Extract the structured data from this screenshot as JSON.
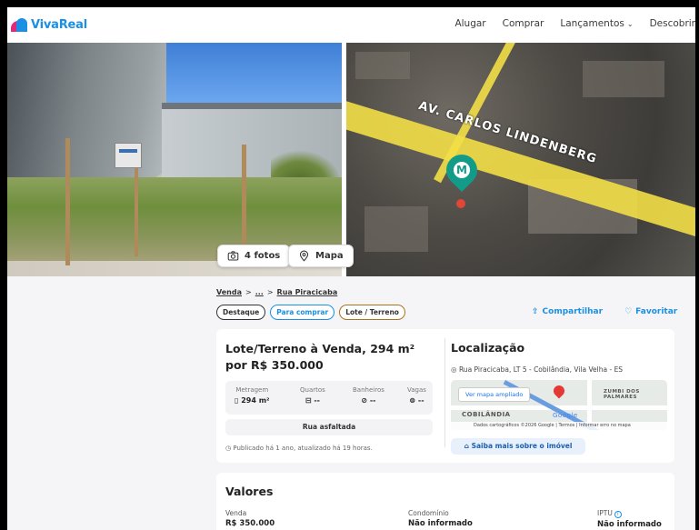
{
  "header": {
    "logo": "VivaReal",
    "nav": [
      {
        "label": "Alugar"
      },
      {
        "label": "Comprar"
      },
      {
        "label": "Lançamentos",
        "has_chevron": true
      },
      {
        "label": "Descobrir"
      }
    ]
  },
  "gallery": {
    "photos_button": "4 fotos",
    "map_button": "Mapa",
    "road_label": "AV. CARLOS LINDENBERG",
    "pin_letter": "M"
  },
  "breadcrumb": {
    "first": "Venda",
    "sep": ">",
    "middle": "...",
    "last": "Rua Piracicaba"
  },
  "tags": [
    "Destaque",
    "Para comprar",
    "Lote / Terreno"
  ],
  "actions": {
    "share": "Compartilhar",
    "favorite": "Favoritar"
  },
  "listing": {
    "title": "Lote/Terreno à Venda, 294 m² por R$ 350.000",
    "stats": [
      {
        "label": "Metragem",
        "value": "294 m²",
        "icon": "ruler-icon"
      },
      {
        "label": "Quartos",
        "value": "--",
        "icon": "bed-icon"
      },
      {
        "label": "Banheiros",
        "value": "--",
        "icon": "shower-icon"
      },
      {
        "label": "Vagas",
        "value": "--",
        "icon": "car-icon"
      }
    ],
    "feature": "Rua asfaltada",
    "published": "Publicado há 1 ano, atualizado há 19 horas."
  },
  "location": {
    "title": "Localização",
    "address": "Rua Piracicaba, LT 5 - Cobilândia, Vila Velha - ES",
    "map_button": "Ver mapa ampliado",
    "map_labels": {
      "district": "COBILÂNDIA",
      "zumbi": "ZUMBI DOS PALMARES",
      "google": "Google"
    },
    "map_footer": "Dados cartográficos ©2026 Google | Termos | Informar erro no mapa",
    "more_button": "Saiba mais sobre o imóvel"
  },
  "values": {
    "title": "Valores",
    "items": [
      {
        "label": "Venda",
        "value": "R$ 350.000"
      },
      {
        "label": "Condomínio",
        "value": "Não informado"
      },
      {
        "label": "IPTU",
        "value": "Não informado"
      }
    ]
  },
  "colors": {
    "brand_blue": "#1a8fe3",
    "brand_pink": "#e4287b",
    "pin_teal": "#139b8a"
  }
}
